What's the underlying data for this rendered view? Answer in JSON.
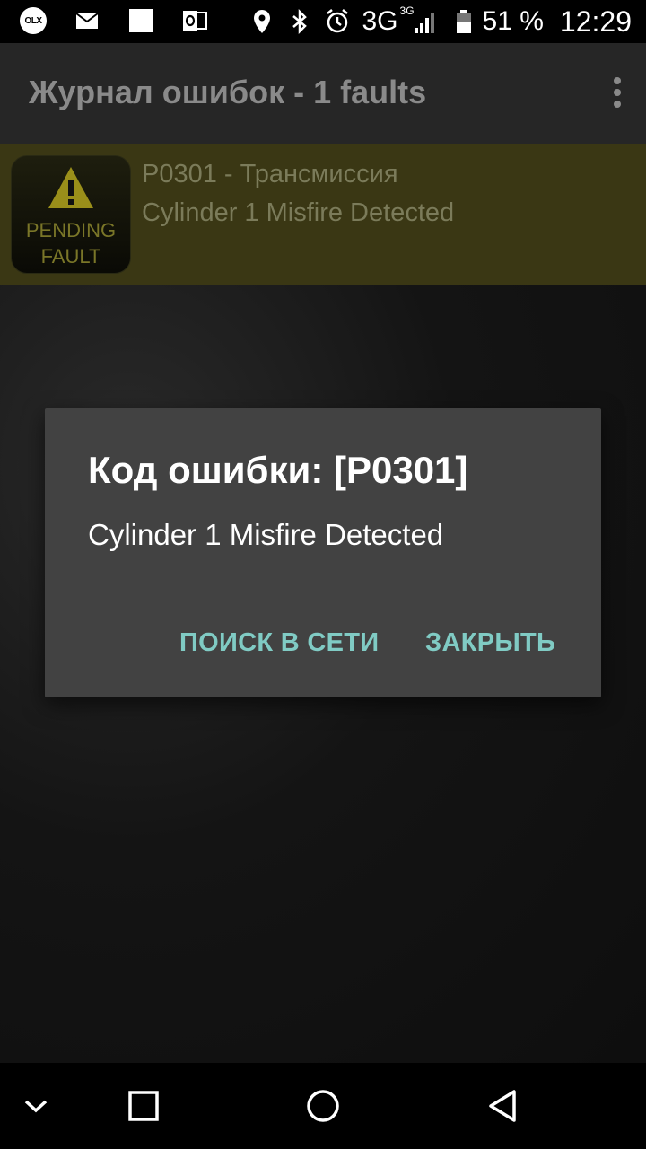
{
  "status_bar": {
    "notification_icons": [
      "olx-icon",
      "mail-icon",
      "blank-notification-icon",
      "outlook-icon"
    ],
    "olx_label": "OLX",
    "network": "3G",
    "network_sup": "3G",
    "battery_percent": "51 %",
    "time": "12:29"
  },
  "app_bar": {
    "title": "Журнал ошибок - 1 faults"
  },
  "fault_list": {
    "items": [
      {
        "badge_line1": "PENDING",
        "badge_line2": "FAULT",
        "title": "P0301 - Трансмиссия",
        "description": "Cylinder 1 Misfire Detected"
      }
    ]
  },
  "dialog": {
    "title": "Код ошибки: [P0301]",
    "message": "Cylinder 1 Misfire Detected",
    "search_button": "ПОИСК В СЕТИ",
    "close_button": "ЗАКРЫТЬ"
  },
  "colors": {
    "accent_button": "#80cbc4",
    "fault_row_bg": "#3a3714",
    "warning_yellow": "#d6cf1d"
  }
}
